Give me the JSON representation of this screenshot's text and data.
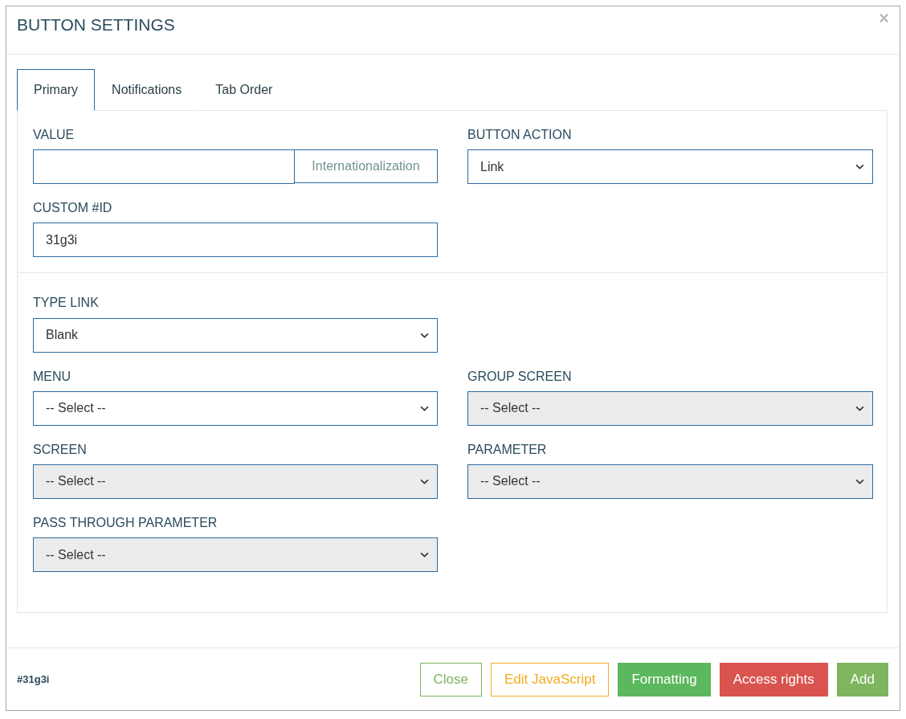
{
  "dialog": {
    "title": "BUTTON SETTINGS",
    "close_glyph": "×"
  },
  "tabs": [
    {
      "label": "Primary",
      "selected": true
    },
    {
      "label": "Notifications",
      "selected": false
    },
    {
      "label": "Tab Order",
      "selected": false
    }
  ],
  "sections": [
    {
      "rows": [
        [
          {
            "label": "VALUE",
            "kind": "input-addon",
            "addon": "Internationalization",
            "disabled": false
          },
          {
            "label": "BUTTON ACTION",
            "kind": "select",
            "value": "Link",
            "disabled": false
          }
        ],
        [
          {
            "label": "CUSTOM #ID",
            "kind": "input",
            "value": "31g3i",
            "disabled": false
          }
        ]
      ]
    },
    {
      "rows": [
        [
          {
            "label": "TYPE LINK",
            "kind": "select",
            "value": "Blank",
            "disabled": false
          }
        ],
        [
          {
            "label": "MENU",
            "kind": "select",
            "value": "-- Select --",
            "disabled": false
          },
          {
            "label": "GROUP SCREEN",
            "kind": "select",
            "value": "-- Select --",
            "disabled": true
          }
        ],
        [
          {
            "label": "SCREEN",
            "kind": "select",
            "value": "-- Select --",
            "disabled": true
          },
          {
            "label": "PARAMETER",
            "kind": "select",
            "value": "-- Select --",
            "disabled": true
          }
        ],
        [
          {
            "label": "PASS THROUGH PARAMETER",
            "kind": "select",
            "value": "-- Select --",
            "disabled": true
          }
        ]
      ]
    }
  ],
  "footer": {
    "id_label": "#31g3i",
    "buttons": [
      {
        "label": "Close",
        "kind": "outline-green"
      },
      {
        "label": "Edit JavaScript",
        "kind": "outline-orange"
      },
      {
        "label": "Formatting",
        "kind": "success"
      },
      {
        "label": "Access rights",
        "kind": "danger"
      },
      {
        "label": "Add",
        "kind": "primary"
      }
    ]
  }
}
